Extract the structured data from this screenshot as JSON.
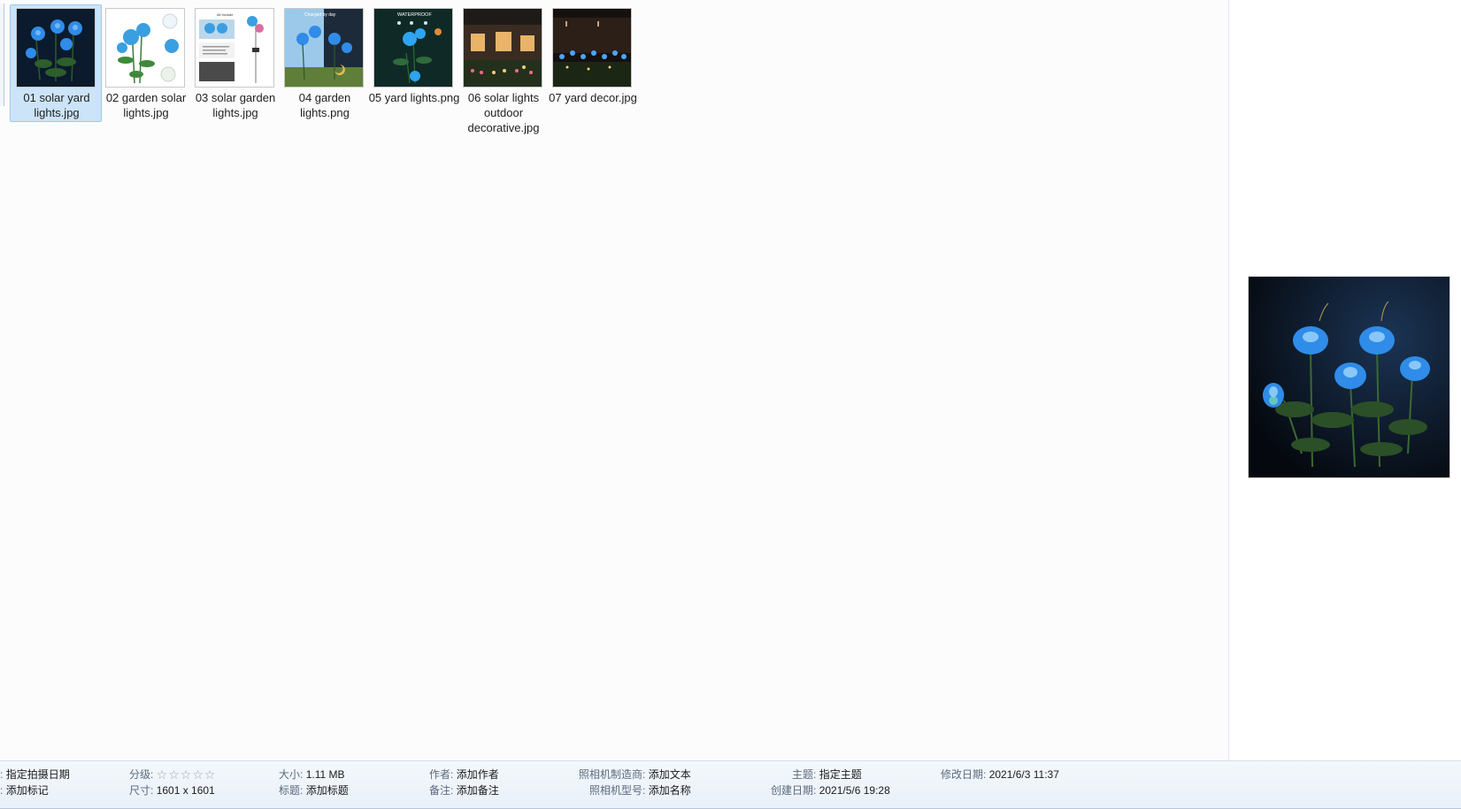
{
  "files": [
    {
      "label": "01 solar yard lights.jpg",
      "selected": true
    },
    {
      "label": "02 garden solar lights.jpg",
      "selected": false
    },
    {
      "label": "03 solar garden lights.jpg",
      "selected": false
    },
    {
      "label": "04 garden lights.png",
      "selected": false
    },
    {
      "label": "05 yard lights.png",
      "selected": false
    },
    {
      "label": "06 solar lights outdoor decorative.jpg",
      "selected": false
    },
    {
      "label": "07 yard decor.jpg",
      "selected": false
    }
  ],
  "thumb_text": {
    "t03_top": "All Include",
    "t04_top": "Charged by day",
    "t05_top": "WATERPROOF"
  },
  "details": {
    "taken_date_value": "指定拍摄日期",
    "tags_value": "添加标记",
    "rating_key": "分级:",
    "rating_stars": "☆☆☆☆☆",
    "dimensions_key": "尺寸:",
    "dimensions_value": "1601 x 1601",
    "size_key": "大小:",
    "size_value": "1.11 MB",
    "title_key": "标题:",
    "title_value": "添加标题",
    "author_key": "作者:",
    "author_value": "添加作者",
    "comments_key": "备注:",
    "comments_value": "添加备注",
    "camera_maker_key": "照相机制造商:",
    "camera_maker_value": "添加文本",
    "camera_model_key": "照相机型号:",
    "camera_model_value": "添加名称",
    "subject_key": "主题:",
    "subject_value": "指定主题",
    "created_key": "创建日期:",
    "created_value": "2021/5/6 19:28",
    "modified_key": "修改日期:",
    "modified_value": "2021/6/3 11:37"
  },
  "colors": {
    "selection_bg": "#cce4f7",
    "selection_border": "#99c9ef",
    "rose_blue": "#2f8ce8",
    "details_bg": "#eef3f9"
  }
}
